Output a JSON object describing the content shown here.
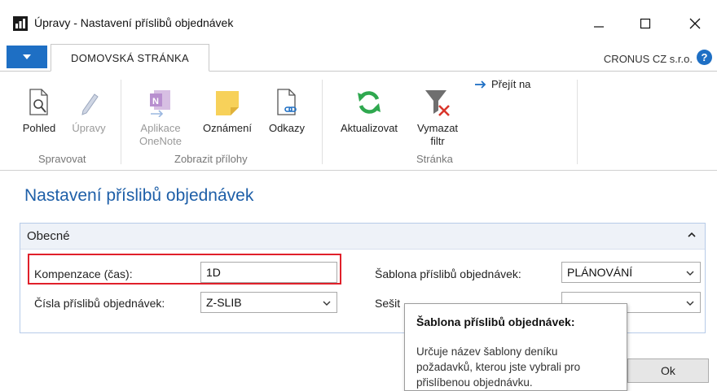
{
  "window": {
    "title": "Úpravy - Nastavení příslibů objednávek"
  },
  "tabs": {
    "home": "DOMOVSKÁ STRÁNKA"
  },
  "company": "CRONUS CZ s.r.o.",
  "help": "?",
  "ribbon": {
    "buttons": [
      {
        "label": "Pohled",
        "icon": "view-icon"
      },
      {
        "label": "Úpravy",
        "icon": "edit-icon"
      },
      {
        "label": "Aplikace\nOneNote",
        "icon": "onenote-icon"
      },
      {
        "label": "Oznámení",
        "icon": "note-icon"
      },
      {
        "label": "Odkazy",
        "icon": "links-icon"
      },
      {
        "label": "Aktualizovat",
        "icon": "refresh-icon"
      },
      {
        "label": "Vymazat\nfiltr",
        "icon": "clear-filter-icon"
      }
    ],
    "goto": "Přejít na",
    "groups": [
      "Spravovat",
      "Zobrazit přílohy",
      "Stránka"
    ]
  },
  "page": {
    "title": "Nastavení příslibů objednávek"
  },
  "panel": {
    "title": "Obecné",
    "fields": {
      "offset_label": "Kompenzace (čas):",
      "offset_value": "1D",
      "nos_label": "Čísla příslibů objednávek:",
      "nos_value": "Z-SLIB",
      "template_label": "Šablona příslibů objednávek:",
      "template_value": "PLÁNOVÁNÍ",
      "batch_label_visible": "Sešit",
      "batch_value_visible": ""
    }
  },
  "tooltip": {
    "title": "Šablona příslibů objednávek:",
    "body": "Určuje název šablony deníku požadavků, kterou jste vybrali pro přislíbenou objednávku."
  },
  "buttons": {
    "ok": "Ok"
  },
  "colors": {
    "accent": "#1e6fc4",
    "title_blue": "#1e5fa8",
    "highlight_red": "#e0202a"
  }
}
